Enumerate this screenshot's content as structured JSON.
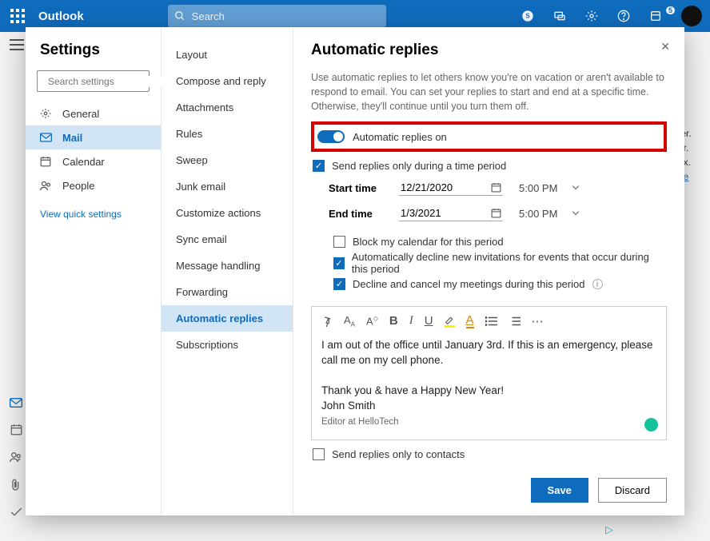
{
  "header": {
    "brand": "Outlook",
    "search_placeholder": "Search",
    "notif_count": "5"
  },
  "settings": {
    "title": "Settings",
    "search_placeholder": "Search settings",
    "categories": [
      "General",
      "Mail",
      "Calendar",
      "People"
    ],
    "quick_link": "View quick settings"
  },
  "sublist": [
    "Layout",
    "Compose and reply",
    "Attachments",
    "Rules",
    "Sweep",
    "Junk email",
    "Customize actions",
    "Sync email",
    "Message handling",
    "Forwarding",
    "Automatic replies",
    "Subscriptions"
  ],
  "panel": {
    "title": "Automatic replies",
    "desc": "Use automatic replies to let others know you're on vacation or aren't available to respond to email. You can set your replies to start and end at a specific time. Otherwise, they'll continue until you turn them off.",
    "toggle_label": "Automatic replies on",
    "time_period_label": "Send replies only during a time period",
    "start_label": "Start time",
    "start_date": "12/21/2020",
    "start_time": "5:00 PM",
    "end_label": "End time",
    "end_date": "1/3/2021",
    "end_time": "5:00 PM",
    "opt_block": "Block my calendar for this period",
    "opt_decline": "Automatically decline new invitations for events that occur during this period",
    "opt_cancel": "Decline and cancel my meetings during this period",
    "body_line1": "I am out of the office until January 3rd. If this is an emergency, please call me on my cell phone.",
    "body_line2": "Thank you & have a Happy New Year!",
    "body_line3": "John Smith",
    "body_sig": "Editor at HelloTech",
    "contacts_only": "Send replies only to contacts",
    "save": "Save",
    "discard": "Discard"
  },
  "backdrop": {
    "t1": "e",
    "t2": "ter.",
    "t3": "er.",
    "t4": "ox.",
    "t5": "ee"
  }
}
